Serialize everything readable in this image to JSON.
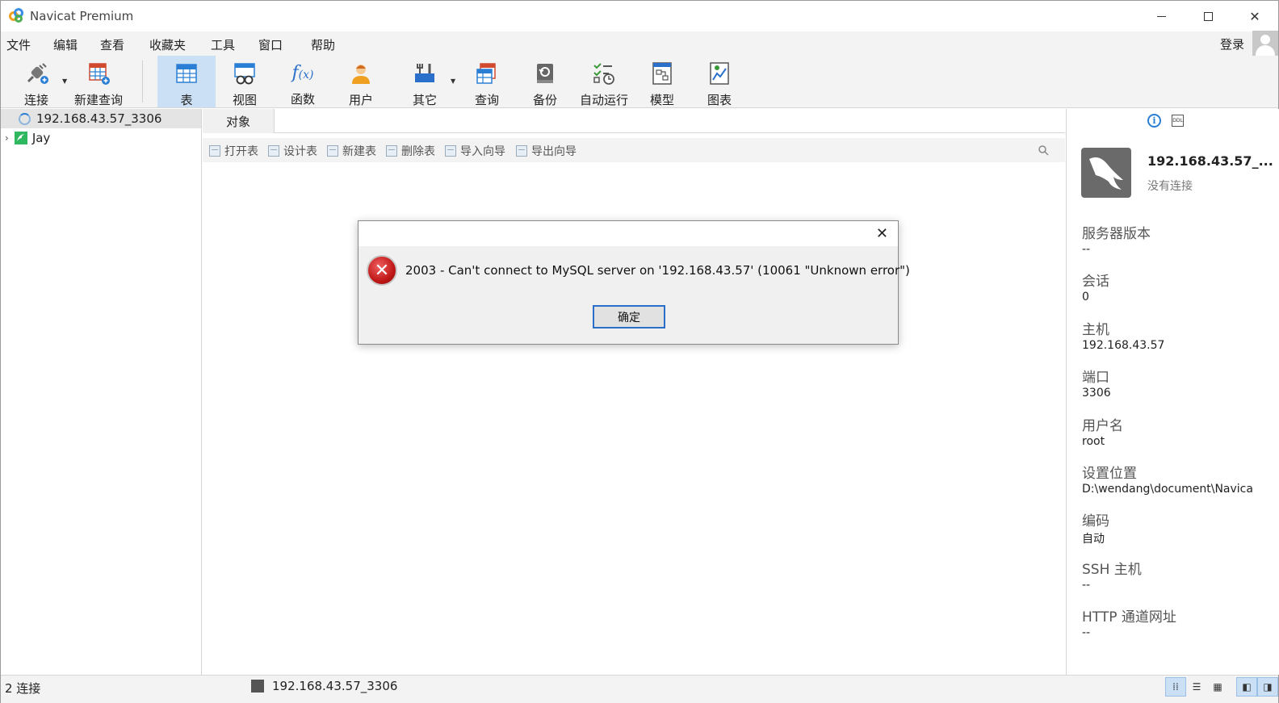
{
  "window": {
    "title": "Navicat Premium"
  },
  "menu": [
    "文件",
    "编辑",
    "查看",
    "收藏夹",
    "工具",
    "窗口",
    "帮助"
  ],
  "account": {
    "login_label": "登录"
  },
  "toolbar": {
    "items": [
      "连接",
      "新建查询",
      "表",
      "视图",
      "函数",
      "用户",
      "其它",
      "查询",
      "备份",
      "自动运行",
      "模型",
      "图表"
    ],
    "active": "表"
  },
  "tree": {
    "items": [
      {
        "label": "192.168.43.57_3306",
        "selected": true
      },
      {
        "label": "Jay",
        "selected": false
      }
    ]
  },
  "tabs": {
    "objects_label": "对象"
  },
  "object_actions": [
    "打开表",
    "设计表",
    "新建表",
    "删除表",
    "导入向导",
    "导出向导"
  ],
  "info_panel": {
    "name": "192.168.43.57_...",
    "status": "没有连接",
    "props": [
      {
        "label": "服务器版本",
        "value": "--"
      },
      {
        "label": "会话",
        "value": "0"
      },
      {
        "label": "主机",
        "value": "192.168.43.57"
      },
      {
        "label": "端口",
        "value": "3306"
      },
      {
        "label": "用户名",
        "value": "root"
      },
      {
        "label": "设置位置",
        "value": "D:\\wendang\\document\\Navica"
      },
      {
        "label": "编码",
        "value": "自动"
      },
      {
        "label": "SSH 主机",
        "value": "--"
      },
      {
        "label": "HTTP 通道网址",
        "value": "--"
      }
    ]
  },
  "dialog": {
    "message": "2003 - Can't connect to MySQL server on '192.168.43.57' (10061 \"Unknown error\")",
    "ok_label": "确定"
  },
  "status": {
    "connections": "2 连接",
    "current_connection": "192.168.43.57_3306"
  },
  "colors": {
    "accent": "#2a6fc9",
    "active_tool_bg": "#cce0f5",
    "error": "#c01818"
  }
}
